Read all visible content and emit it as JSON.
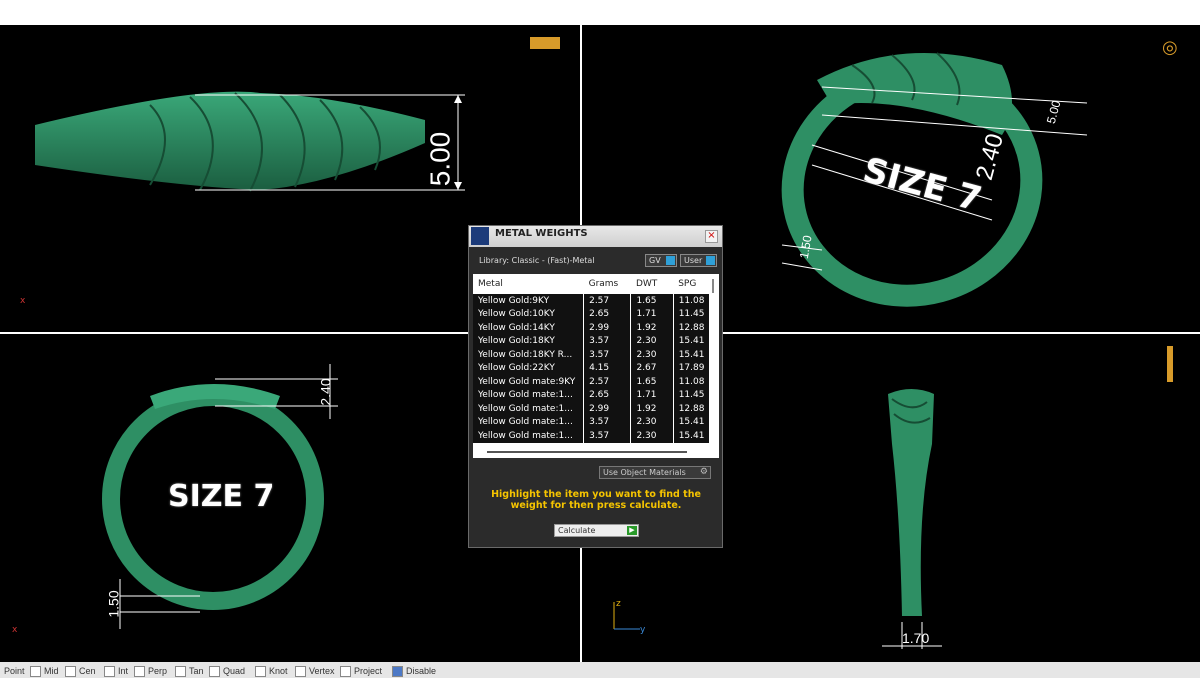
{
  "viewports": {
    "top_left": {
      "dim_label": "5.00"
    },
    "top_right": {
      "dim_labels": [
        "5.00",
        "2.40",
        "1.50"
      ],
      "size_label": "SIZE 7"
    },
    "bottom_left": {
      "dim_labels": [
        "2.40",
        "1.50"
      ],
      "size_label": "SIZE 7",
      "axis_x": "x"
    },
    "bottom_right": {
      "dim_label": "1.70",
      "axis_y": "y",
      "axis_z": "z"
    }
  },
  "dialog": {
    "title": "METAL WEIGHTS",
    "library": "Library: Classic - (Fast)-Metal",
    "toggle_gv": "GV",
    "toggle_user": "User",
    "columns": [
      "Metal",
      "Grams",
      "DWT",
      "SPG"
    ],
    "rows": [
      [
        "Yellow Gold:9KY",
        "2.57",
        "1.65",
        "11.08"
      ],
      [
        "Yellow Gold:10KY",
        "2.65",
        "1.71",
        "11.45"
      ],
      [
        "Yellow Gold:14KY",
        "2.99",
        "1.92",
        "12.88"
      ],
      [
        "Yellow Gold:18KY",
        "3.57",
        "2.30",
        "15.41"
      ],
      [
        "Yellow Gold:18KY R...",
        "3.57",
        "2.30",
        "15.41"
      ],
      [
        "Yellow Gold:22KY",
        "4.15",
        "2.67",
        "17.89"
      ],
      [
        "Yellow Gold mate:9KY",
        "2.57",
        "1.65",
        "11.08"
      ],
      [
        "Yellow Gold mate:1...",
        "2.65",
        "1.71",
        "11.45"
      ],
      [
        "Yellow Gold mate:1...",
        "2.99",
        "1.92",
        "12.88"
      ],
      [
        "Yellow Gold mate:1...",
        "3.57",
        "2.30",
        "15.41"
      ],
      [
        "Yellow Gold mate:1...",
        "3.57",
        "2.30",
        "15.41"
      ]
    ],
    "use_object_materials": "Use Object Materials",
    "hint": "Highlight the item you want to find the weight for then press calculate.",
    "calculate": "Calculate"
  },
  "statusbar": {
    "snaps": [
      {
        "label": "Point",
        "on": false
      },
      {
        "label": "Mid",
        "on": false
      },
      {
        "label": "Cen",
        "on": false
      },
      {
        "label": "Int",
        "on": false
      },
      {
        "label": "Perp",
        "on": false
      },
      {
        "label": "Tan",
        "on": false
      },
      {
        "label": "Quad",
        "on": false
      },
      {
        "label": "Knot",
        "on": false
      },
      {
        "label": "Vertex",
        "on": false
      },
      {
        "label": "Project",
        "on": false
      },
      {
        "label": "Disable",
        "on": true
      }
    ]
  },
  "colors": {
    "ring": "#2e8f64",
    "ring_dark": "#1a5c3e",
    "viewport_bg": "#000000",
    "hint": "#f5c400"
  }
}
